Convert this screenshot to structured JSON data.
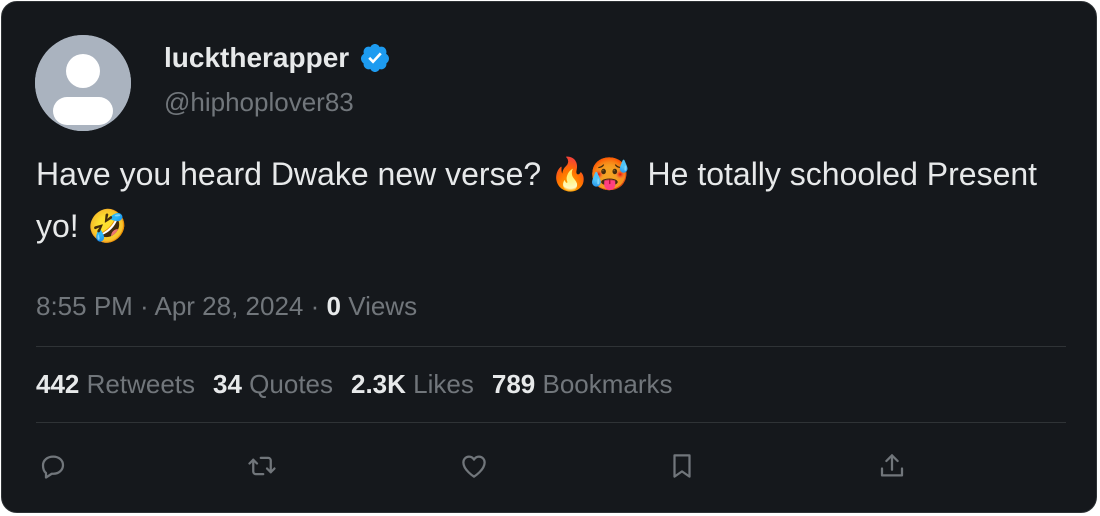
{
  "user": {
    "display_name": "lucktherapper",
    "handle": "@hiphoplover83",
    "verified": true,
    "verified_color": "#1d9bf0"
  },
  "tweet": {
    "text": "Have you heard Dwake new verse? 🔥🥵  He totally schooled Present yo! 🤣",
    "time": "8:55 PM · Apr 28, 2024 · ",
    "views_count": "0",
    "views_label": " Views"
  },
  "stats": [
    {
      "count": "442",
      "label": "Retweets"
    },
    {
      "count": "34",
      "label": "Quotes"
    },
    {
      "count": "2.3K",
      "label": "Likes"
    },
    {
      "count": "789",
      "label": "Bookmarks"
    }
  ],
  "actions": [
    "reply-icon",
    "retweet-icon",
    "like-icon",
    "bookmark-icon",
    "share-icon"
  ],
  "colors": {
    "background": "#15181c",
    "text": "#e7e9ea",
    "muted": "#71767b",
    "divider": "#2f3336"
  }
}
